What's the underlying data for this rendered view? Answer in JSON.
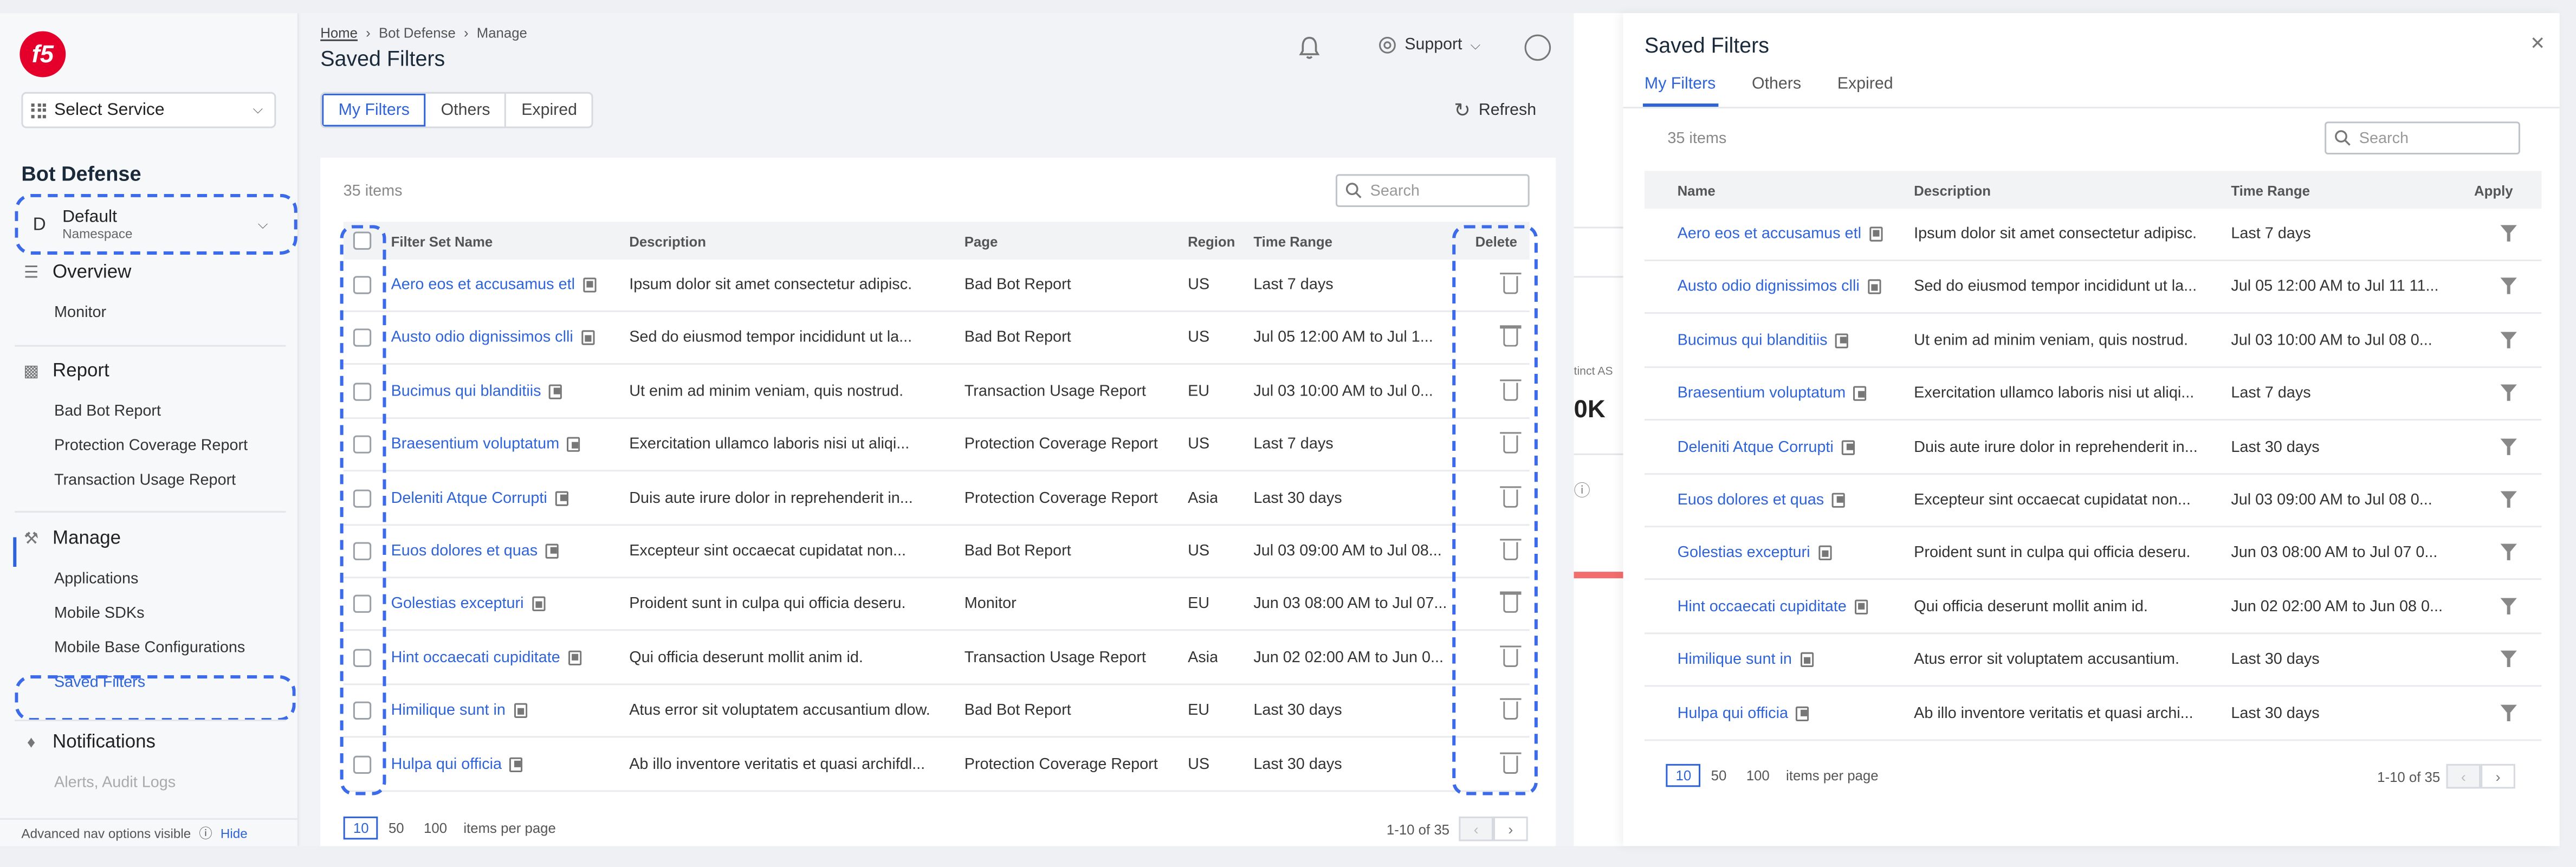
{
  "sidebar": {
    "logo_text": "f5",
    "select_service": "Select Service",
    "section_title": "Bot Defense",
    "namespace": {
      "letter": "D",
      "name": "Default",
      "sub": "Namespace"
    },
    "overview": {
      "label": "Overview",
      "items": [
        "Monitor"
      ]
    },
    "report": {
      "label": "Report",
      "items": [
        "Bad Bot Report",
        "Protection Coverage Report",
        "Transaction Usage Report"
      ]
    },
    "manage": {
      "label": "Manage",
      "items": [
        "Applications",
        "Mobile SDKs",
        "Mobile Base Configurations",
        "Saved Filters"
      ]
    },
    "notifications": {
      "label": "Notifications",
      "items": [
        "Alerts, Audit Logs"
      ]
    },
    "footer": {
      "text": "Advanced nav options visible",
      "hide": "Hide"
    }
  },
  "header": {
    "breadcrumb": [
      "Home",
      "Bot Defense",
      "Manage"
    ],
    "title": "Saved Filters",
    "support": "Support"
  },
  "main": {
    "tabs": [
      "My Filters",
      "Others",
      "Expired"
    ],
    "refresh": "Refresh",
    "items_count": "35 items",
    "search_placeholder": "Search",
    "columns": [
      "Filter Set Name",
      "Description",
      "Page",
      "Region",
      "Time Range",
      "Delete"
    ],
    "rows": [
      {
        "name": "Aero eos et accusamus etl",
        "description": "Ipsum dolor sit amet consectetur adipisc.",
        "page": "Bad Bot Report",
        "region": "US",
        "time": "Last 7 days"
      },
      {
        "name": "Austo odio dignissimos clli",
        "description": "Sed do eiusmod tempor incididunt ut la...",
        "page": "Bad Bot Report",
        "region": "US",
        "time": "Jul 05 12:00 AM to Jul 1..."
      },
      {
        "name": "Bucimus qui blanditiis",
        "description": "Ut enim ad minim veniam, quis nostrud.",
        "page": "Transaction Usage Report",
        "region": "EU",
        "time": "Jul 03 10:00 AM to Jul 0..."
      },
      {
        "name": "Braesentium voluptatum",
        "description": "Exercitation ullamco laboris nisi ut aliqi...",
        "page": "Protection Coverage Report",
        "region": "US",
        "time": "Last 7 days"
      },
      {
        "name": "Deleniti Atque Corrupti",
        "description": "Duis aute irure dolor in reprehenderit in...",
        "page": "Protection Coverage Report",
        "region": "Asia",
        "time": "Last 30 days"
      },
      {
        "name": "Euos dolores et quas",
        "description": "Excepteur sint occaecat cupidatat non...",
        "page": "Bad Bot Report",
        "region": "US",
        "time": "Jul 03 09:00 AM to Jul 08..."
      },
      {
        "name": "Golestias excepturi",
        "description": "Proident sunt in culpa qui officia deseru.",
        "page": "Monitor",
        "region": "EU",
        "time": "Jun 03 08:00 AM to Jul 07..."
      },
      {
        "name": "Hint occaecati cupiditate",
        "description": "Qui officia deserunt mollit anim id.",
        "page": "Transaction Usage Report",
        "region": "Asia",
        "time": "Jun 02 02:00 AM to Jun 0..."
      },
      {
        "name": "Himilique sunt in",
        "description": "Atus error sit voluptatem accusantium dlow.",
        "page": "Bad Bot Report",
        "region": "EU",
        "time": "Last 30 days"
      },
      {
        "name": "Hulpa qui officia",
        "description": "Ab illo inventore veritatis et quasi archifdl...",
        "page": "Protection Coverage Report",
        "region": "US",
        "time": "Last 30 days"
      }
    ],
    "pager": {
      "sizes": [
        "10",
        "50",
        "100"
      ],
      "per_page": "items per page",
      "range": "1-10 of 35"
    }
  },
  "background": {
    "label": "tinct AS",
    "value": "0K"
  },
  "panel": {
    "title": "Saved Filters",
    "tabs": [
      "My Filters",
      "Others",
      "Expired"
    ],
    "items_count": "35 items",
    "search_placeholder": "Search",
    "columns": [
      "Name",
      "Description",
      "Time Range",
      "Apply"
    ],
    "rows": [
      {
        "name": "Aero eos et accusamus etl",
        "description": "Ipsum dolor sit amet consectetur adipisc.",
        "time": "Last 7 days"
      },
      {
        "name": "Austo odio dignissimos clli",
        "description": "Sed do eiusmod tempor incididunt ut la...",
        "time": "Jul 05 12:00 AM to Jul 11 11..."
      },
      {
        "name": "Bucimus qui blanditiis",
        "description": "Ut enim ad minim veniam, quis nostrud.",
        "time": "Jul 03 10:00 AM to Jul 08 0..."
      },
      {
        "name": "Braesentium voluptatum",
        "description": "Exercitation ullamco laboris nisi ut aliqi...",
        "time": "Last 7 days"
      },
      {
        "name": "Deleniti Atque Corrupti",
        "description": "Duis aute irure dolor in reprehenderit in...",
        "time": "Last 30 days"
      },
      {
        "name": "Euos dolores et quas",
        "description": "Excepteur sint occaecat cupidatat non...",
        "time": "Jul 03 09:00 AM to Jul 08 0..."
      },
      {
        "name": "Golestias excepturi",
        "description": "Proident sunt in culpa qui officia deseru.",
        "time": "Jun 03 08:00 AM to Jul 07 0..."
      },
      {
        "name": "Hint occaecati cupiditate",
        "description": "Qui officia deserunt mollit anim id.",
        "time": "Jun 02 02:00 AM to Jun 08 0..."
      },
      {
        "name": "Himilique sunt in",
        "description": "Atus error sit voluptatem accusantium.",
        "time": "Last 30 days"
      },
      {
        "name": "Hulpa qui officia",
        "description": "Ab illo inventore veritatis et quasi archi...",
        "time": "Last 30 days"
      }
    ],
    "pager": {
      "sizes": [
        "10",
        "50",
        "100"
      ],
      "per_page": "items per page",
      "range": "1-10 of 35"
    }
  },
  "colors": {
    "accent": "#2f63d8",
    "brand": "#e4002b",
    "annotation": "#3b6bea"
  }
}
